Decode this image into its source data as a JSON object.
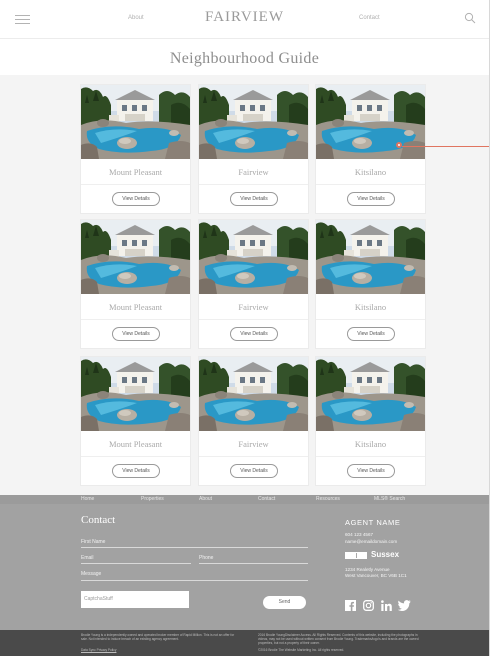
{
  "header": {
    "about": "About",
    "logo": "FAIRVIEW",
    "contact": "Contact"
  },
  "page_title": "Neighbourhood Guide",
  "cards": [
    {
      "name": "Mount Pleasant",
      "button": "View Details"
    },
    {
      "name": "Fairview",
      "button": "View Details"
    },
    {
      "name": "Kitsilano",
      "button": "View Details"
    },
    {
      "name": "Mount Pleasant",
      "button": "View Details"
    },
    {
      "name": "Fairview",
      "button": "View Details"
    },
    {
      "name": "Kitsilano",
      "button": "View Details"
    },
    {
      "name": "Mount Pleasant",
      "button": "View Details"
    },
    {
      "name": "Fairview",
      "button": "View Details"
    },
    {
      "name": "Kitsilano",
      "button": "View Details"
    }
  ],
  "footer_nav": [
    "Home",
    "Properties",
    "About",
    "Contact",
    "Resources",
    "MLS® Search"
  ],
  "contact": {
    "heading": "Contact",
    "first_name": "First Name",
    "email": "Email",
    "phone": "Phone",
    "message": "Message",
    "captcha": "CaptchaStuff",
    "send": "Send"
  },
  "agent": {
    "name": "AGENT NAME",
    "phone": "604 123 4567",
    "email": "name@emaildomain.com",
    "brand": "Sussex",
    "address1": "1234 Realetly Avenue",
    "address2": "West Vancouver, BC V6B 1C1"
  },
  "legal": {
    "left": "Brodie Young is a independently owned and operated broker member of Rapid Million. This is not an offer for sale. Not intended to induce breach of an existing agency agreement.",
    "left_link": "Data Sync Privacy Policy",
    "right": "2016 Brodie YoungDisclaimer Access. All Rights Reserved. Contents of this website, including the photographs in videos, may not be used without written consent from Brodie Young. Trademarks/logo's and brands are the owned properties, but not a property of their owner.",
    "right_bottom": "©2016 Brodie The Website Marketing Inc. All rights reserved."
  },
  "colors": {
    "footer_bg": "#a2a2a2",
    "legal_bg": "#4a4a4a",
    "annotation": "#e07560"
  }
}
